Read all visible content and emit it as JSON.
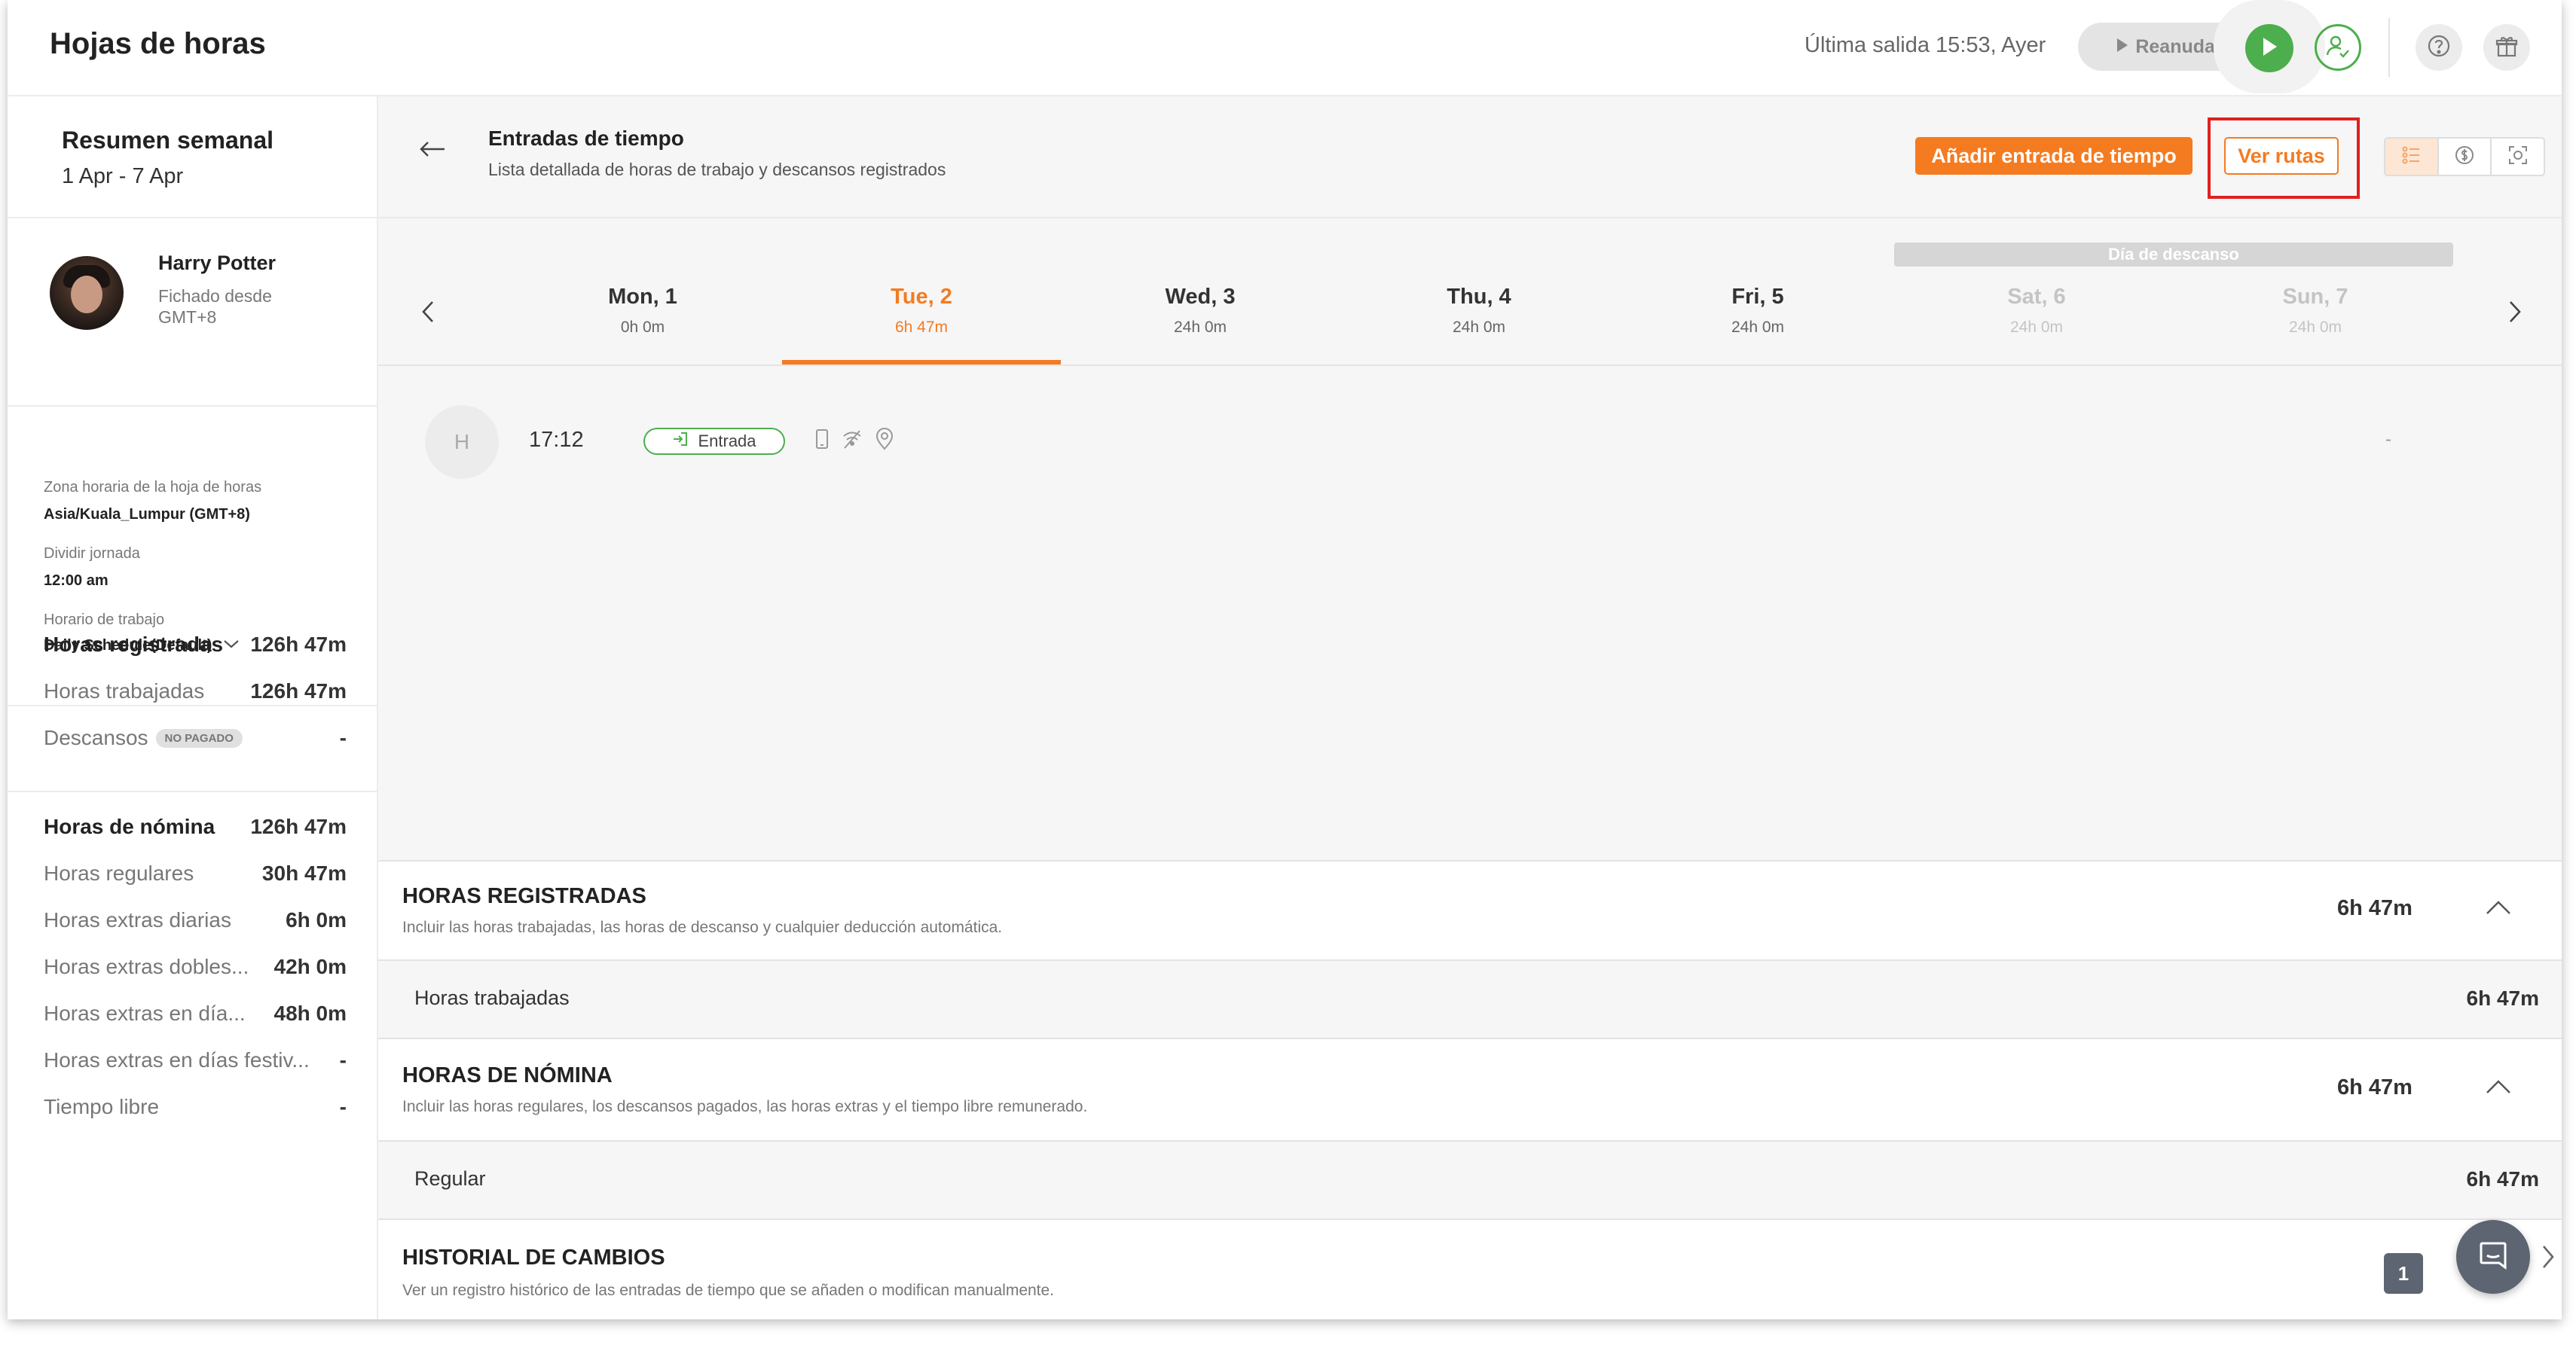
{
  "header": {
    "title": "Hojas de horas",
    "last_out": "Última salida 15:53, Ayer",
    "resume_label": "Reanudar"
  },
  "sidebar": {
    "week_title": "Resumen semanal",
    "week_range": "1 Apr - 7 Apr",
    "user": {
      "name": "Harry Potter",
      "clocked_from": "Fichado desde",
      "timezone_short": "GMT+8"
    },
    "info": {
      "tz_label": "Zona horaria de la hoja de horas",
      "tz_value": "Asia/Kuala_Lumpur (GMT+8)",
      "split_label": "Dividir jornada",
      "split_value": "12:00 am",
      "schedule_label": "Horario de trabajo",
      "schedule_value": "Daily Schedule(Default)"
    },
    "stats_tracked": [
      {
        "label": "Horas registradas",
        "value": "126h 47m"
      },
      {
        "label": "Horas trabajadas",
        "value": "126h 47m"
      },
      {
        "label": "Descansos",
        "value": "-",
        "badge": "NO PAGADO"
      }
    ],
    "stats_payroll": [
      {
        "label": "Horas de nómina",
        "value": "126h 47m"
      },
      {
        "label": "Horas regulares",
        "value": "30h 47m"
      },
      {
        "label": "Horas extras diarias",
        "value": "6h 0m"
      },
      {
        "label": "Horas extras dobles...",
        "value": "42h 0m"
      },
      {
        "label": "Horas extras en día...",
        "value": "48h 0m"
      },
      {
        "label": "Horas extras en días festiv...",
        "value": "-"
      },
      {
        "label": "Tiempo libre",
        "value": "-"
      }
    ]
  },
  "main": {
    "title": "Entradas de tiempo",
    "subtitle": "Lista detallada de horas de trabajo y descansos registrados",
    "add_entry_label": "Añadir entrada de tiempo",
    "view_routes_label": "Ver rutas",
    "rest_day_label": "Día de descanso",
    "days": [
      {
        "name": "Mon, 1",
        "hours": "0h 0m"
      },
      {
        "name": "Tue, 2",
        "hours": "6h 47m"
      },
      {
        "name": "Wed, 3",
        "hours": "24h 0m"
      },
      {
        "name": "Thu, 4",
        "hours": "24h 0m"
      },
      {
        "name": "Fri, 5",
        "hours": "24h 0m"
      },
      {
        "name": "Sat, 6",
        "hours": "24h 0m"
      },
      {
        "name": "Sun, 7",
        "hours": "24h 0m"
      }
    ],
    "entry": {
      "avatar_initial": "H",
      "time": "17:12",
      "type": "Entrada",
      "note": "-"
    },
    "tracked_section": {
      "title": "HORAS REGISTRADAS",
      "subtitle": "Incluir las horas trabajadas, las horas de descanso y cualquier deducción automática.",
      "value": "6h 47m",
      "row_label": "Horas trabajadas",
      "row_value": "6h 47m"
    },
    "payroll_section": {
      "title": "HORAS DE NÓMINA",
      "subtitle": "Incluir las horas regulares, los descansos pagados, las horas extras y el tiempo libre remunerado.",
      "value": "6h 47m",
      "row_label": "Regular",
      "row_value": "6h 47m"
    },
    "history_section": {
      "title": "HISTORIAL DE CAMBIOS",
      "subtitle": "Ver un registro histórico de las entradas de tiempo que se añaden o modifican manualmente.",
      "count": "1"
    }
  },
  "colors": {
    "accent": "#f47b20",
    "green": "#4cae4c",
    "highlight": "#e02020"
  }
}
